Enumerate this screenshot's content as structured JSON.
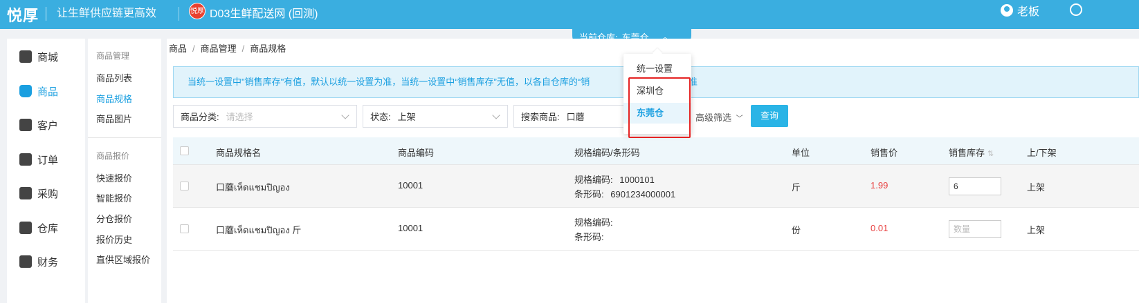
{
  "header": {
    "brand": "悦厚",
    "slogan": "让生鲜供应链更高效",
    "shop_logo_text": "悦厚",
    "shop_name": "D03生鲜配送网 (回测)",
    "user_name": "老板"
  },
  "warehouse": {
    "label": "当前仓库:",
    "current": "东莞仓",
    "options": [
      "统一设置",
      "深圳仓",
      "东莞仓"
    ],
    "selected_index": 2
  },
  "sidebar": {
    "items": [
      {
        "label": "商城",
        "icon": "store-icon"
      },
      {
        "label": "商品",
        "icon": "bag-icon",
        "active": true
      },
      {
        "label": "客户",
        "icon": "customer-icon"
      },
      {
        "label": "订单",
        "icon": "order-icon"
      },
      {
        "label": "采购",
        "icon": "basket-icon"
      },
      {
        "label": "仓库",
        "icon": "warehouse-icon"
      },
      {
        "label": "财务",
        "icon": "wallet-icon"
      }
    ]
  },
  "subnav": {
    "group1_title": "商品管理",
    "group1_items": [
      "商品列表",
      "商品规格",
      "商品图片"
    ],
    "group2_title": "商品报价",
    "group2_items": [
      "快速报价",
      "智能报价",
      "分仓报价",
      "报价历史",
      "直供区域报价"
    ],
    "active": "商品规格"
  },
  "breadcrumb": [
    "商品",
    "商品管理",
    "商品规格"
  ],
  "notice": "当统一设置中\"销售库存\"有值，默认以统一设置为准，当统一设置中“销售库存”无值，以各自仓库的“销",
  "notice_tail": "准",
  "filters": {
    "category_label": "商品分类:",
    "category_placeholder": "请选择",
    "status_label": "状态:",
    "status_value": "上架",
    "search_label": "搜索商品:",
    "search_value": "口蘑",
    "advanced_label": "高级筛选",
    "query_button": "查询"
  },
  "table": {
    "columns": [
      "商品规格名",
      "商品编码",
      "规格编码/条形码",
      "单位",
      "销售价",
      "销售库存",
      "上/下架"
    ],
    "rows": [
      {
        "name": "口蘑เห็ดแชมปิญอง",
        "code": "10001",
        "spec_code_label": "规格编码:",
        "spec_code": "1000101",
        "barcode_label": "条形码:",
        "barcode": "6901234000001",
        "unit": "斤",
        "price": "1.99",
        "stock": "6",
        "status": "上架"
      },
      {
        "name": "口蘑เห็ดแชมปิญอง 斤",
        "code": "10001",
        "spec_code_label": "规格编码:",
        "spec_code": "",
        "barcode_label": "条形码:",
        "barcode": "",
        "unit": "份",
        "price": "0.01",
        "stock_placeholder": "数量",
        "status": "上架"
      }
    ]
  },
  "colors": {
    "header_bg": "#3aaee0",
    "accent": "#1a9fe0",
    "price": "#e84040",
    "highlight_box": "#e52222"
  }
}
